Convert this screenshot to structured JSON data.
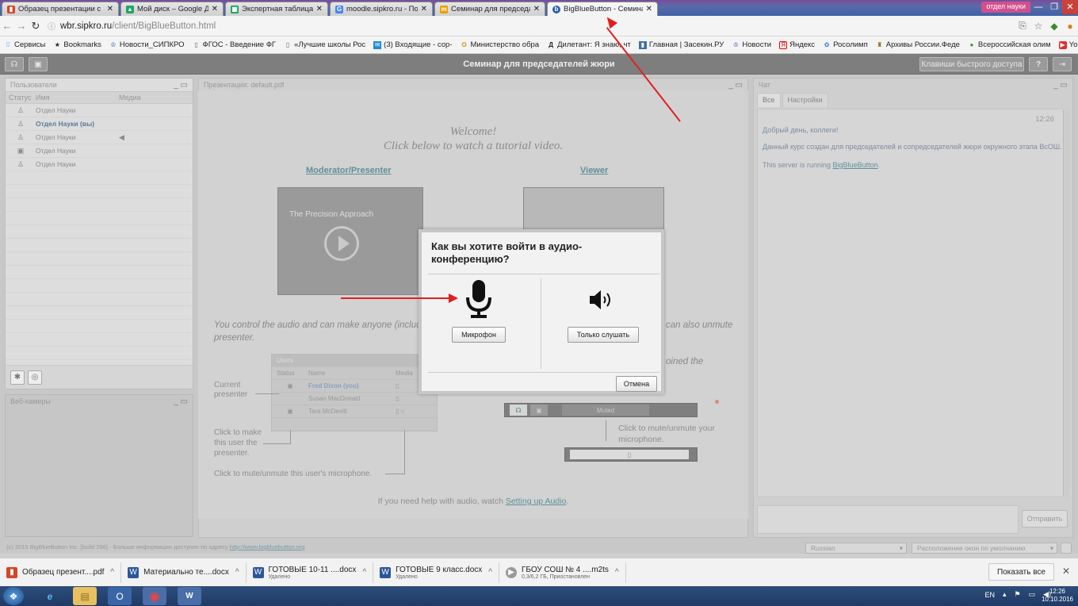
{
  "browser": {
    "tabs": [
      {
        "label": "Образец презентации с",
        "color": "#d24726"
      },
      {
        "label": "Мой диск – Google Диск",
        "color": "#1fa463"
      },
      {
        "label": "Экспертная таблица М",
        "color": "#0f9d58"
      },
      {
        "label": "moodle.sipkro.ru - Поис",
        "color": "#4285f4"
      },
      {
        "label": "Семинар для председат",
        "color": "#e8a000"
      },
      {
        "label": "BigBlueButton - Семинар",
        "color": "#2b5fa8"
      }
    ],
    "profile_chip": "отдел науки",
    "url_prefix": "wbr.sipkro.ru",
    "url_path": "/client/BigBlueButton.html",
    "bookmarks": [
      {
        "label": "Сервисы",
        "icon": "apps-icon"
      },
      {
        "label": "Bookmarks",
        "icon": "star-icon"
      },
      {
        "label": "Новости_СИПКРО",
        "icon": "sipkro-icon"
      },
      {
        "label": "ФГОС - Введение ФГ",
        "icon": "page-icon"
      },
      {
        "label": "«Лучшие школы Рос",
        "icon": "page-icon"
      },
      {
        "label": "(3) Входящие - сор-",
        "icon": "mail-icon"
      },
      {
        "label": "Министерство обра",
        "icon": "ministry-icon"
      },
      {
        "label": "Дилетант: Я знаю, чт",
        "icon": "d-icon"
      },
      {
        "label": "Главная | Засекин.РУ",
        "icon": "page-icon"
      },
      {
        "label": "Новости",
        "icon": "sipkro-icon"
      },
      {
        "label": "Яндекс",
        "icon": "yandex-icon"
      },
      {
        "label": "Росолимп",
        "icon": "rosolimp-icon"
      },
      {
        "label": "Архивы России.Феде",
        "icon": "archive-icon"
      },
      {
        "label": "Всероссийская олим",
        "icon": "olymp-icon"
      },
      {
        "label": "YouTube",
        "icon": "youtube-icon"
      }
    ],
    "more_bookmarks": "»"
  },
  "app": {
    "room_title": "Семинар для председателей жюри",
    "shortcuts_label": "Клавиши быстрого доступа",
    "help_label": "?",
    "users": {
      "title": "Пользователи",
      "col_status": "Статус",
      "col_name": "Имя",
      "col_media": "Медиа",
      "rows": [
        {
          "status": "♙",
          "name": "Отдел Науки",
          "media": ""
        },
        {
          "status": "♙",
          "name": "Отдел Науки (вы)",
          "media": ""
        },
        {
          "status": "♙",
          "name": "Отдел Науки",
          "media": "◀"
        },
        {
          "status": "▣",
          "name": "Отдел Науки",
          "media": ""
        },
        {
          "status": "♙",
          "name": "Отдел Науки",
          "media": ""
        }
      ]
    },
    "webcams_title": "Веб-камеры",
    "presentation": {
      "title": "Презентация: default.pdf",
      "welcome": "Welcome!",
      "click_below": "Click below to watch a tutorial video.",
      "moderator_link": "Moderator/Presenter",
      "viewer_link": "Viewer",
      "thumb_caption": "The Precision Approach",
      "control_text_1": "You control the audio and can make anyone (including",
      "control_text_2": "presenter.",
      "unmute_text": "can also unmute",
      "joined_text": "oined the",
      "mini_users_title": "Users",
      "mini_col_status": "Status",
      "mini_col_name": "Name",
      "mini_col_media": "Media",
      "mini_rows": [
        "Fred Dixon (you)",
        "Susan MacDonald",
        "Tara McDevitt"
      ],
      "current_presenter_1": "Current",
      "current_presenter_2": "presenter",
      "make_presenter_1": "Click to make",
      "make_presenter_2": "this user the",
      "make_presenter_3": "presenter.",
      "mute_user_text": "Click to mute/unmute this user's microphone.",
      "mute_mic_1": "Click to mute/unmute your",
      "mute_mic_2": "microphone.",
      "muted_label": "Muted",
      "help_prefix": "If you need help with audio, watch ",
      "help_link": "Setting up Audio",
      "help_suffix": "."
    },
    "chat": {
      "title": "Чат",
      "tab_all": "Все",
      "tab_settings": "Настройки",
      "time": "12:26",
      "messages": [
        "Добрый день, коллеги!",
        "Данный курс создан для председателей и сопредседателей жюри окружного этапа ВсОШ.",
        "This server is running "
      ],
      "bbb_link": "BigBlueButton",
      "send_label": "Отправить"
    },
    "footer_copyright": "(c) 2015 BigBlueButton Inc. [build 266] - Больше информации доступно по адресу ",
    "footer_link": "http://www.bigbluebutton.org",
    "language": "Russian",
    "layout": "Расположение окон по умолчанию"
  },
  "modal": {
    "title": "Как вы хотите войти в аудио-конференцию?",
    "mic_label": "Микрофон",
    "listen_label": "Только слушать",
    "cancel_label": "Отмена"
  },
  "downloads": [
    {
      "name": "Образец презент....pdf",
      "sub": "",
      "color": "#d24726",
      "icon": "pdf-icon"
    },
    {
      "name": "Материально те....docx",
      "sub": "",
      "color": "#2b579a",
      "icon": "docx-icon"
    },
    {
      "name": "ГОТОВЫЕ 10-11 ....docx",
      "sub": "Удалено",
      "color": "#2b579a",
      "icon": "docx-icon"
    },
    {
      "name": "ГОТОВЫЕ 9 класс.docx",
      "sub": "Удалено",
      "color": "#2b579a",
      "icon": "docx-icon"
    },
    {
      "name": "ГБОУ СОШ № 4 ....m2ts",
      "sub": "0,3/6,2 ГБ, Приостановлен",
      "color": "#999999",
      "icon": "video-icon"
    }
  ],
  "show_all_label": "Показать все",
  "tray": {
    "lang": "EN",
    "time": "12:26",
    "date": "10.10.2016"
  }
}
